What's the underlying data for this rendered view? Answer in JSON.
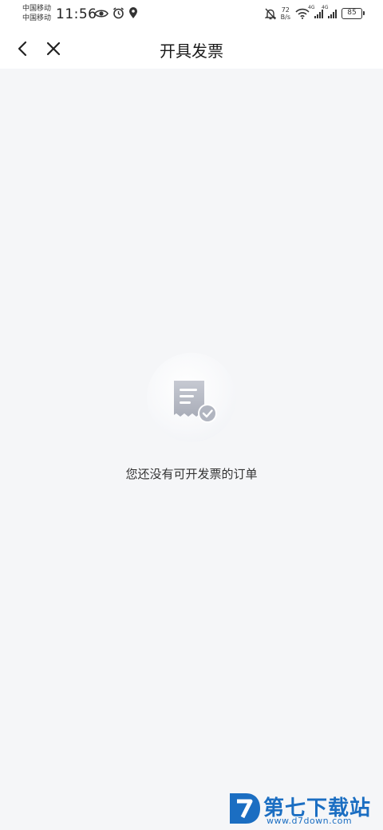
{
  "status_bar": {
    "carrier_1": "中国移动",
    "carrier_2": "中国移动",
    "time": "11:56",
    "net_speed_value": "72",
    "net_speed_unit": "B/s",
    "signal_1_label": "4G",
    "signal_2_label": "4G",
    "battery": "85"
  },
  "nav": {
    "title": "开具发票"
  },
  "empty_state": {
    "message": "您还没有可开发票的订单"
  },
  "watermark": {
    "title": "第七下载站",
    "url": "www.d7down.com"
  },
  "colors": {
    "background": "#f5f6f8",
    "header": "#ffffff",
    "icon_gray": "#b8bcc6",
    "watermark_blue": "#1b6ec2"
  }
}
